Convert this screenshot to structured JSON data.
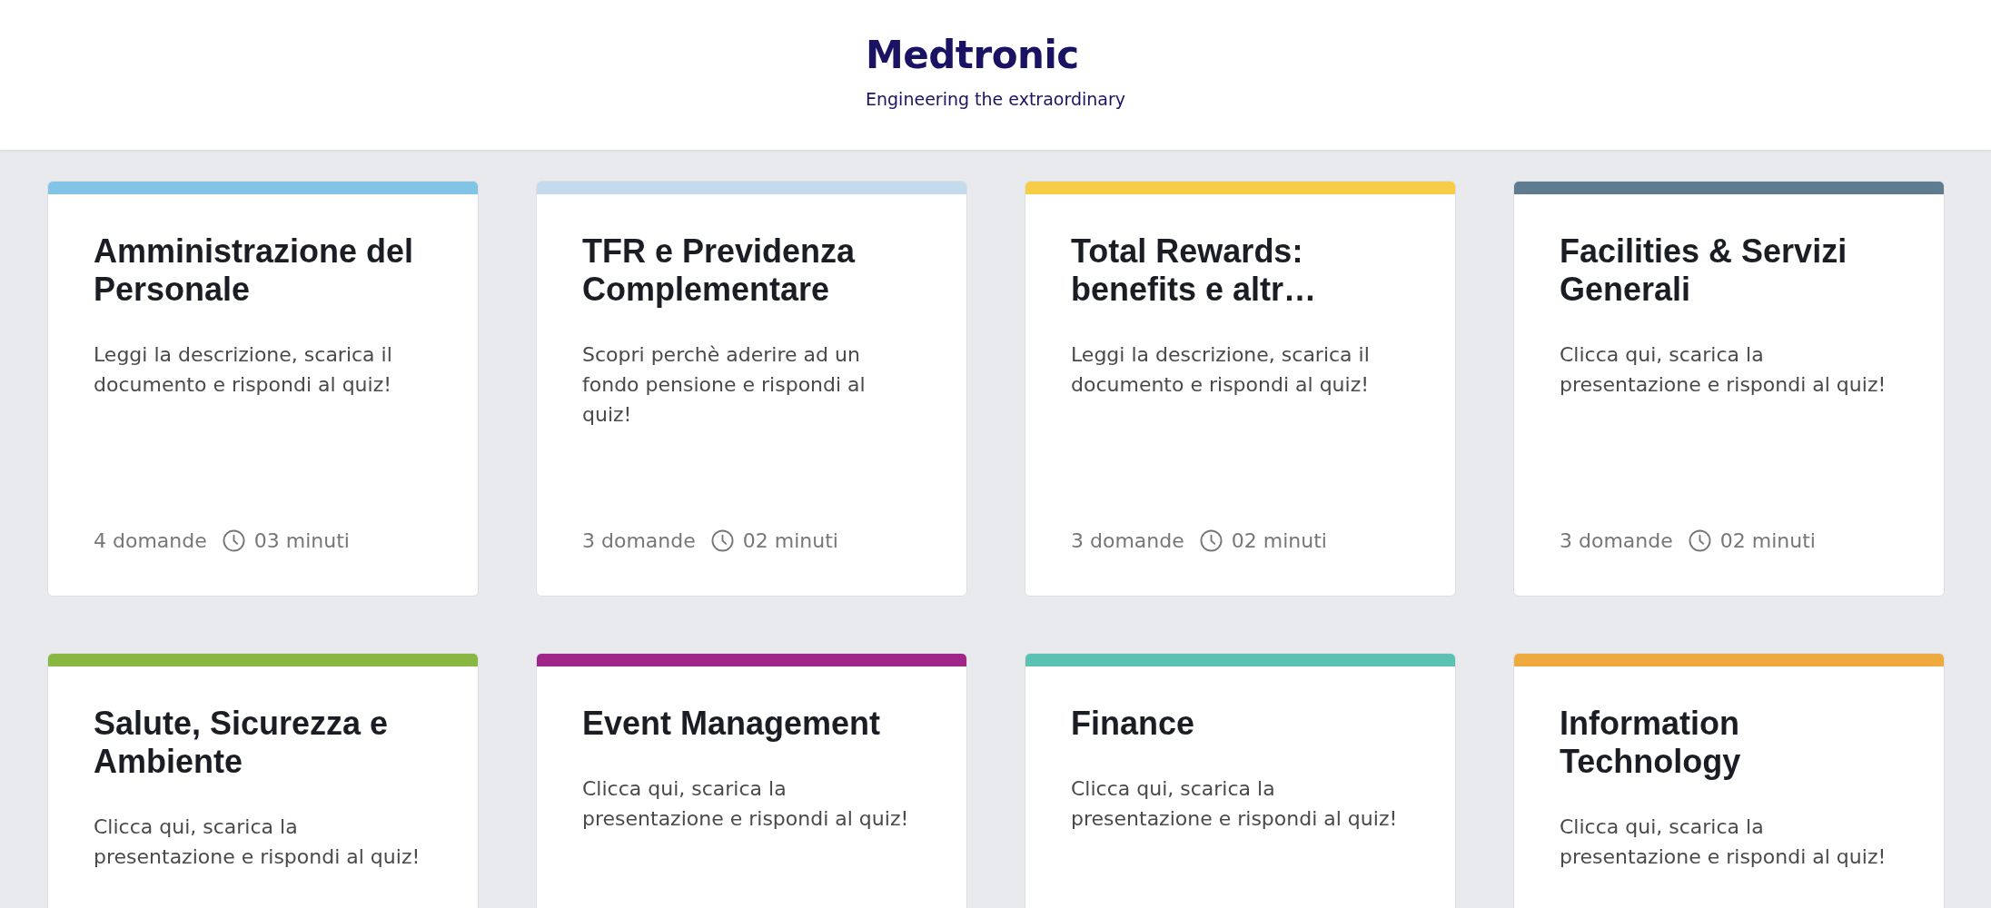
{
  "header": {
    "logo": "Medtronic",
    "tagline": "Engineering the extraordinary"
  },
  "cards": [
    {
      "title": "Amministrazione del Personale",
      "description": "Leggi la descrizione, scarica il documento e rispondi al quiz!",
      "color": "#82c4e5",
      "questions": "4 domande",
      "duration": "03 minuti"
    },
    {
      "title": "TFR e Previdenza Complementare",
      "description": "Scopri perchè aderire ad un fondo pensione e rispondi al quiz!",
      "color": "#c3dbec",
      "questions": "3 domande",
      "duration": "02 minuti"
    },
    {
      "title": "Total Rewards: benefits e altr…",
      "description": "Leggi la descrizione, scarica il documento e rispondi al quiz!",
      "color": "#f7cd47",
      "questions": "3 domande",
      "duration": "02 minuti"
    },
    {
      "title": "Facilities & Servizi Generali",
      "description": "Clicca qui, scarica la presentazione e rispondi al quiz!",
      "color": "#5f7b8f",
      "questions": "3 domande",
      "duration": "02 minuti"
    },
    {
      "title": "Salute, Sicurezza e Ambiente",
      "description": "Clicca qui, scarica la presentazione e rispondi al quiz!",
      "color": "#88b842"
    },
    {
      "title": "Event Management",
      "description": "Clicca qui, scarica la presentazione e rispondi al quiz!",
      "color": "#a0268a"
    },
    {
      "title": "Finance",
      "description": "Clicca qui, scarica la presentazione e rispondi al quiz!",
      "color": "#5bc2b3"
    },
    {
      "title": "Information Technology",
      "description": "Clicca qui, scarica la presentazione e rispondi al quiz!",
      "color": "#eeaa3e"
    }
  ]
}
